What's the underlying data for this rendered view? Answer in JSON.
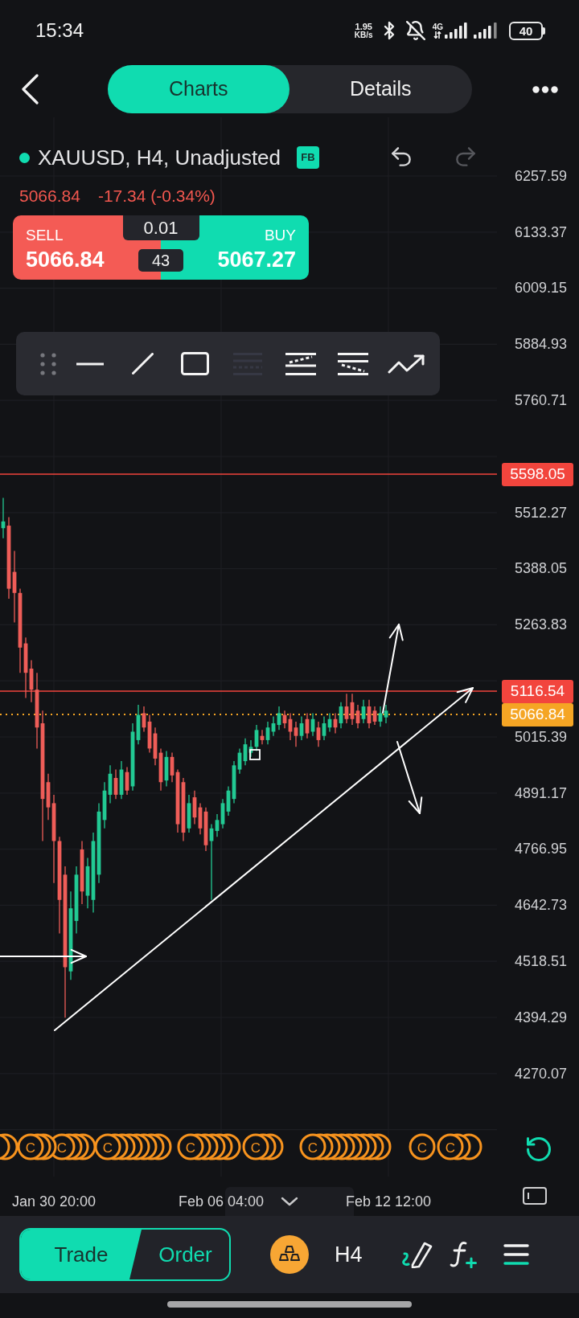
{
  "status_bar": {
    "time": "15:34",
    "speed_value": "1.95",
    "speed_unit": "KB/s",
    "network": "4G",
    "battery": "40"
  },
  "header": {
    "tabs": [
      {
        "label": "Charts",
        "selected": true
      },
      {
        "label": "Details",
        "selected": false
      }
    ]
  },
  "symbol": {
    "name": "XAUUSD, H4, Unadjusted",
    "badge": "FB",
    "price": "5066.84",
    "change": "-17.34 (-0.34%)"
  },
  "history": [
    {
      "kind": "undo",
      "disabled": false
    },
    {
      "kind": "redo",
      "disabled": true
    }
  ],
  "order_panel": {
    "sell_label": "SELL",
    "sell_price": "5066.84",
    "buy_label": "BUY",
    "buy_price": "5067.27",
    "volume": "0.01",
    "spread": "43"
  },
  "drawing_toolbar": [
    {
      "kind": "hline",
      "disabled": false
    },
    {
      "kind": "segment",
      "disabled": false
    },
    {
      "kind": "rectangle",
      "disabled": false
    },
    {
      "kind": "lines",
      "disabled": true
    },
    {
      "kind": "channelup",
      "disabled": false
    },
    {
      "kind": "channeldown",
      "disabled": false
    },
    {
      "kind": "polyline",
      "disabled": false
    }
  ],
  "price_axis": [
    "6257.59",
    "6133.37",
    "6009.15",
    "5884.93",
    "5760.71",
    "5512.27",
    "5388.05",
    "5263.83",
    "5015.39",
    "4891.17",
    "4766.95",
    "4642.73",
    "4518.51",
    "4394.29",
    "4270.07"
  ],
  "price_markers": [
    {
      "kind": "level",
      "label": "5598.05",
      "color": "#f2453d"
    },
    {
      "kind": "level",
      "label": "5116.54",
      "color": "#f2453d"
    },
    {
      "kind": "current",
      "label": "5066.84",
      "color": "#f5a524"
    }
  ],
  "event_markers": [
    {
      "kind": "ring"
    },
    {
      "kind": "ring"
    },
    {
      "kind": "labeled",
      "label": "C"
    },
    {
      "kind": "ring"
    },
    {
      "kind": "ring"
    },
    {
      "kind": "labeled",
      "label": "C"
    },
    {
      "kind": "ring"
    },
    {
      "kind": "ring"
    },
    {
      "kind": "ring"
    },
    {
      "kind": "labeled",
      "label": "C"
    },
    {
      "kind": "ring"
    },
    {
      "kind": "ring"
    },
    {
      "kind": "ring"
    },
    {
      "kind": "ring"
    },
    {
      "kind": "ring"
    },
    {
      "kind": "ring"
    },
    {
      "kind": "ring"
    },
    {
      "kind": "labeled",
      "label": "C"
    },
    {
      "kind": "ring"
    },
    {
      "kind": "ring"
    },
    {
      "kind": "ring"
    },
    {
      "kind": "ring"
    },
    {
      "kind": "ring"
    },
    {
      "kind": "labeled",
      "label": "C"
    },
    {
      "kind": "ring"
    },
    {
      "kind": "ring"
    },
    {
      "kind": "labeled",
      "label": "C"
    },
    {
      "kind": "ring"
    },
    {
      "kind": "ring"
    },
    {
      "kind": "ring"
    },
    {
      "kind": "ring"
    },
    {
      "kind": "ring"
    },
    {
      "kind": "ring"
    },
    {
      "kind": "ring"
    },
    {
      "kind": "ring"
    },
    {
      "kind": "ring"
    },
    {
      "kind": "labeled",
      "label": "C"
    },
    {
      "kind": "labeled",
      "label": "C"
    },
    {
      "kind": "ring"
    },
    {
      "kind": "ring"
    }
  ],
  "time_axis": [
    "Jan 30 20:00",
    "Feb 06 04:00",
    "Feb 12 12:00"
  ],
  "bottom_bar": {
    "trade_toggle": [
      {
        "label": "Trade",
        "selected": true
      },
      {
        "label": "Order",
        "selected": false
      }
    ],
    "timeframe": "H4"
  }
}
